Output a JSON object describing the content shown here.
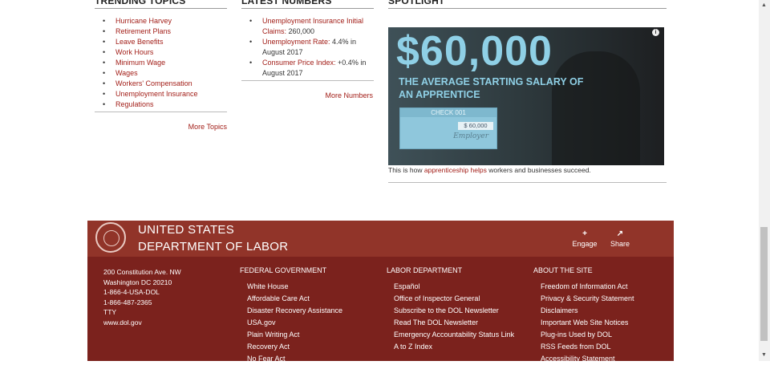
{
  "trending": {
    "heading": "Trending Topics",
    "items": [
      "Hurricane Harvey",
      "Retirement Plans",
      "Leave Benefits",
      "Work Hours",
      "Minimum Wage",
      "Wages",
      "Workers' Compensation",
      "Unemployment Insurance",
      "Regulations"
    ],
    "more": "More Topics"
  },
  "latest": {
    "heading": "Latest Numbers",
    "items": [
      {
        "link": "Unemployment Insurance Initial Claims:",
        "value": " 260,000"
      },
      {
        "link": "Unemployment Rate:",
        "value": " 4.4% in August 2017"
      },
      {
        "link": "Consumer Price Index:",
        "value": " +0.4% in August 2017"
      }
    ],
    "more": "More Numbers"
  },
  "spotlight": {
    "heading": "Spotlight",
    "big_number": "$60,000",
    "subtitle": "THE AVERAGE STARTING SALARY OF AN APPRENTICE",
    "check_title": "CHECK 001",
    "check_amount": "$ 60,000",
    "check_signature": "Employer",
    "info": "i",
    "caption_pre": "This is how ",
    "caption_link": "apprenticeship helps",
    "caption_post": " workers and businesses succeed."
  },
  "footer": {
    "org_line1": "UNITED STATES",
    "org_line2": "DEPARTMENT OF LABOR",
    "engage": "Engage",
    "engage_icon": "+",
    "share": "Share",
    "share_icon": "↗",
    "address": [
      "200 Constitution Ave. NW",
      "Washington DC 20210",
      "1-866-4-USA-DOL",
      "1-866-487-2365",
      "TTY",
      "www.dol.gov"
    ],
    "columns": [
      {
        "heading": "Federal Government",
        "links": [
          "White House",
          "Affordable Care Act",
          "Disaster Recovery Assistance",
          "USA.gov",
          "Plain Writing Act",
          "Recovery Act",
          "No Fear Act"
        ]
      },
      {
        "heading": "Labor Department",
        "links": [
          "Español",
          "Office of Inspector General",
          "Subscribe to the DOL Newsletter",
          "Read The DOL Newsletter",
          "Emergency Accountability Status Link",
          "A to Z Index"
        ]
      },
      {
        "heading": "About the Site",
        "links": [
          "Freedom of Information Act",
          "Privacy & Security Statement",
          "Disclaimers",
          "Important Web Site Notices",
          "Plug-ins Used by DOL",
          "RSS Feeds from DOL",
          "Accessibility Statement"
        ]
      }
    ]
  }
}
